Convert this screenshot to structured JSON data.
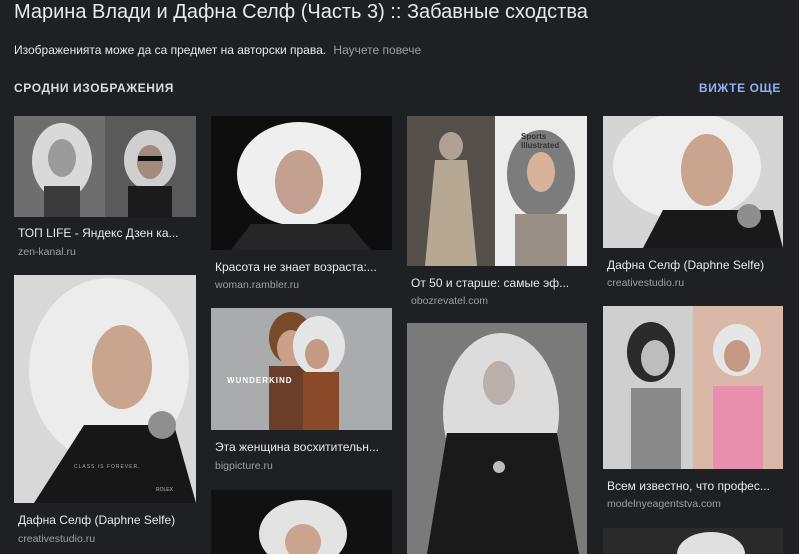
{
  "page": {
    "title": "Марина Влади и Дафна Селф (Часть 3) :: Забавные сходства",
    "copyright_notice": "Изображенията може да са предмет на авторски права.",
    "learn_more": "Научете повече"
  },
  "related": {
    "heading": "СРОДНИ ИЗОБРАЖЕНИЯ",
    "see_more": "ВИЖТЕ ОЩЕ",
    "items": [
      {
        "caption": "ТОП LIFE - Яндекс Дзен ка...",
        "source": "zen-kanal.ru"
      },
      {
        "caption": "Красота не знает возраста:...",
        "source": "woman.rambler.ru"
      },
      {
        "caption": "От 50 и старше: самые эф...",
        "source": "obozrevatel.com"
      },
      {
        "caption": "Дафна Селф (Daphne Selfe)",
        "source": "creativestudio.ru"
      },
      {
        "caption": "Дафна Селф (Daphne Selfe)",
        "source": "creativestudio.ru"
      },
      {
        "caption": "Эта женщина восхитительн...",
        "source": "bigpicture.ru"
      },
      {
        "caption": "",
        "source": ""
      },
      {
        "caption": "Всем известно, что профес...",
        "source": "modelnyeagentstva.com"
      },
      {
        "caption": "",
        "source": ""
      },
      {
        "caption": "",
        "source": ""
      }
    ],
    "image_overlays": {
      "wunderkind": "WUNDERKIND",
      "sports_illustrated": "Sports Illustrated",
      "class_is_forever": "CLASS IS FOREVER.",
      "rolex": "ROLEX"
    }
  },
  "colors": {
    "background": "#1f2023",
    "text": "#e8eaed",
    "muted": "#9aa0a6",
    "accent": "#8ab4f8"
  }
}
